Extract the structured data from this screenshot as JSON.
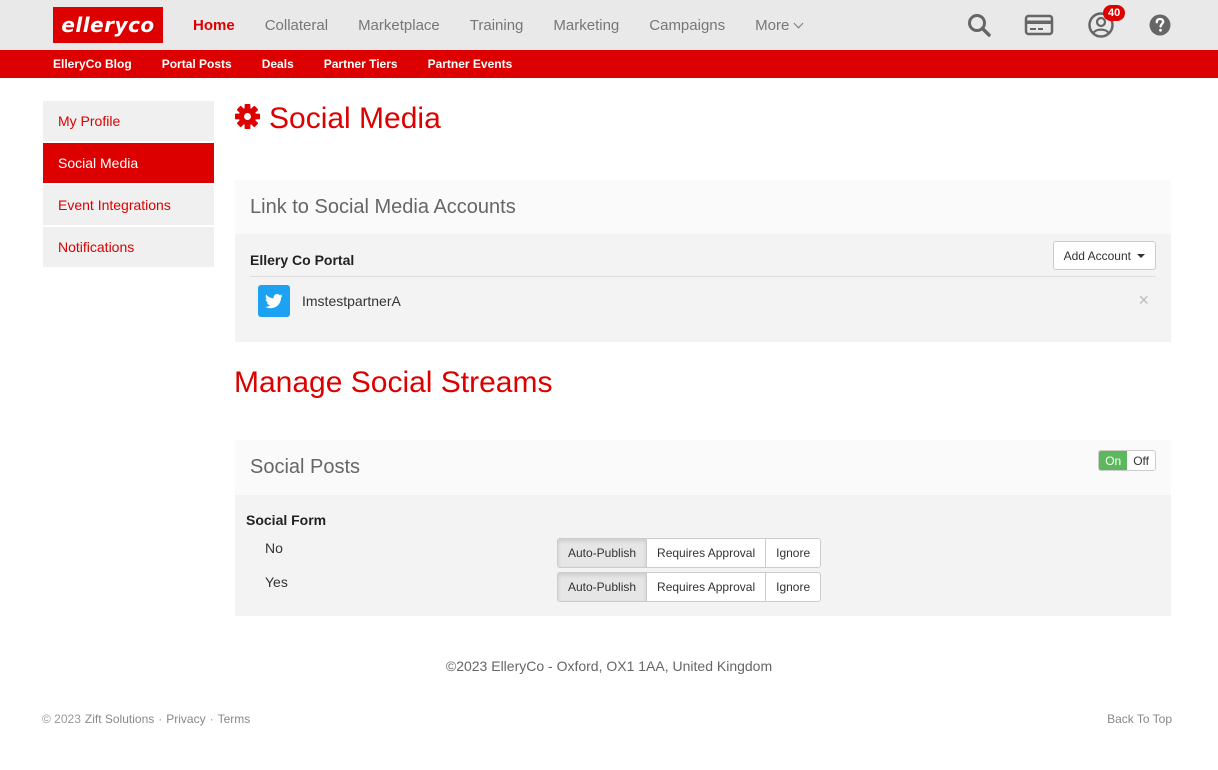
{
  "brand": {
    "logo_text": "elleryco",
    "accent": "#dd0000",
    "success": "#5cb85c",
    "twitter": "#1da1f2"
  },
  "main_nav": {
    "home": "Home",
    "collateral": "Collateral",
    "marketplace": "Marketplace",
    "training": "Training",
    "marketing": "Marketing",
    "campaigns": "Campaigns",
    "more": "More"
  },
  "top_icons": {
    "search": "search-icon",
    "card": "credit-card-icon",
    "account": "user-icon",
    "help": "help-icon",
    "notifications_count": "40"
  },
  "sub_nav": {
    "blog": "ElleryCo Blog",
    "portal_posts": "Portal Posts",
    "deals": "Deals",
    "partner_tiers": "Partner Tiers",
    "partner_events": "Partner Events"
  },
  "sidebar": {
    "items": [
      {
        "label": "My Profile"
      },
      {
        "label": "Social Media"
      },
      {
        "label": "Event Integrations"
      },
      {
        "label": "Notifications"
      }
    ]
  },
  "page": {
    "title": "Social Media"
  },
  "link_accounts": {
    "heading": "Link to Social Media Accounts",
    "portal_name": "Ellery Co Portal",
    "add_account_label": "Add Account",
    "accounts": [
      {
        "network": "twitter",
        "name": "ImstestpartnerA"
      }
    ],
    "remove_symbol": "×"
  },
  "streams": {
    "heading": "Manage Social Streams",
    "social_posts": {
      "heading": "Social Posts",
      "toggle_on": "On",
      "toggle_off": "Off",
      "toggle_state": "On"
    },
    "form": {
      "title": "Social Form",
      "rows": [
        {
          "label": "No",
          "options": [
            "Auto-Publish",
            "Requires Approval",
            "Ignore"
          ],
          "selected": "Auto-Publish"
        },
        {
          "label": "Yes",
          "options": [
            "Auto-Publish",
            "Requires Approval",
            "Ignore"
          ],
          "selected": "Auto-Publish"
        }
      ]
    }
  },
  "footer": {
    "address": "©2023 ElleryCo - Oxford, OX1 1AA, United Kingdom",
    "copyright_prefix": "© 2023",
    "company": "Zift Solutions",
    "privacy": "Privacy",
    "terms": "Terms",
    "separator": "·",
    "back_to_top": "Back To Top"
  }
}
